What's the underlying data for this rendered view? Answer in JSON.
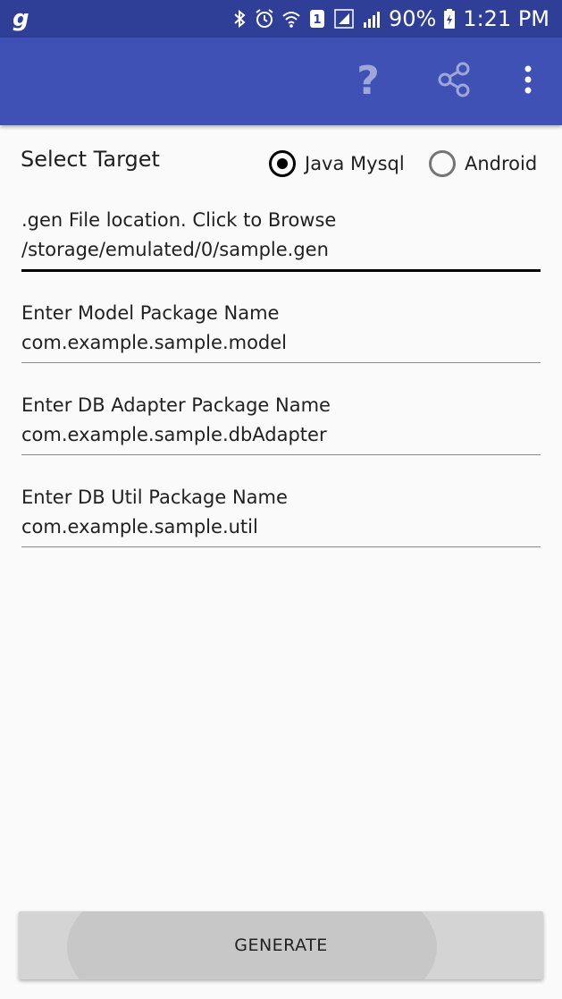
{
  "status_bar": {
    "app_glyph": "g",
    "battery": "90%",
    "time": "1:21 PM",
    "sim_slot": "1",
    "icons": [
      "bluetooth-icon",
      "alarm-icon",
      "wifi-icon",
      "sim-icon",
      "signal-icon",
      "signal-icon",
      "battery-icon"
    ]
  },
  "toolbar": {
    "help_glyph": "?",
    "actions": [
      "help-icon",
      "share-icon",
      "more-vert-icon"
    ]
  },
  "target": {
    "label": "Select Target",
    "options": [
      {
        "label": "Java Mysql",
        "selected": true
      },
      {
        "label": "Android",
        "selected": false
      }
    ]
  },
  "fields": [
    {
      "label": ".gen File location. Click to Browse",
      "value": "/storage/emulated/0/sample.gen"
    },
    {
      "label": "Enter Model Package Name",
      "value": "com.example.sample.model"
    },
    {
      "label": "Enter DB Adapter Package Name",
      "value": "com.example.sample.dbAdapter"
    },
    {
      "label": "Enter DB Util Package Name",
      "value": "com.example.sample.util"
    }
  ],
  "generate_button": {
    "label": "GENERATE"
  },
  "colors": {
    "status_bar": "#2f3e96",
    "app_bar": "#3f51b5",
    "background": "#fafafa",
    "button": "#d4d4d4"
  }
}
